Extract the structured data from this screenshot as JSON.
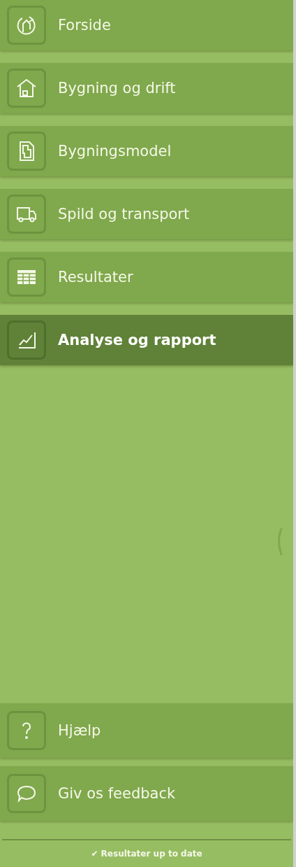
{
  "nav_items": [
    {
      "label": "Forside",
      "kind": "home-cycle",
      "selected": false
    },
    {
      "label": "Bygning og drift",
      "kind": "house",
      "selected": false
    },
    {
      "label": "Bygningsmodel",
      "kind": "document",
      "selected": false
    },
    {
      "label": "Spild og transport",
      "kind": "truck",
      "selected": false
    },
    {
      "label": "Resultater",
      "kind": "table",
      "selected": false
    },
    {
      "label": "Analyse og rapport",
      "kind": "chart",
      "selected": true
    }
  ],
  "footer_items": [
    {
      "label": "Hjælp",
      "kind": "help"
    },
    {
      "label": "Giv os feedback",
      "kind": "speech"
    }
  ],
  "status": "✔ Resultater up to date"
}
